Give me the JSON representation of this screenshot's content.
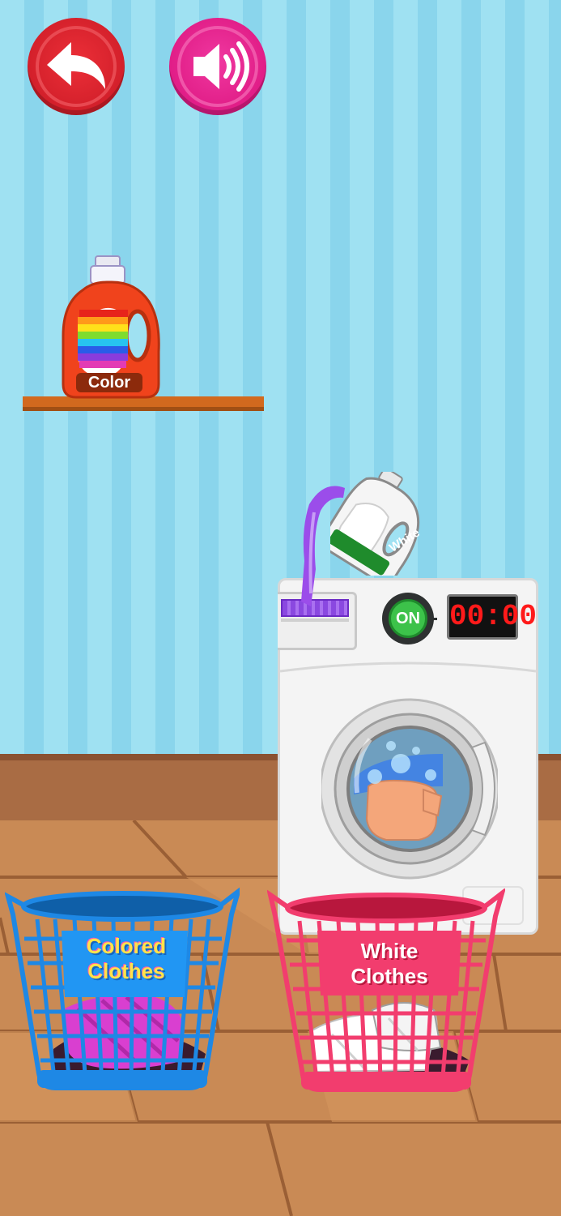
{
  "colors": {
    "wall_stripe_light": "#9fe1f2",
    "wall_stripe_dark": "#8ad5ec",
    "floor": "#c98a55",
    "back_button": "#e2242f",
    "sound_button": "#e81c8c",
    "colored_basket": "#2196f3",
    "white_basket": "#f23d6e",
    "timer_digits": "#ff1a1a",
    "on_button": "#3cc24a",
    "detergent_liquid": "#9b4dea"
  },
  "icons": {
    "back": "back-arrow-icon",
    "sound": "speaker-icon"
  },
  "detergents": {
    "color_bottle_label": "Color",
    "white_bottle_label": "White"
  },
  "washer": {
    "power_label": "ON",
    "timer": "00:00"
  },
  "baskets": {
    "colored": {
      "line1": "Colored",
      "line2": "Clothes"
    },
    "white": {
      "line1": "White",
      "line2": "Clothes"
    }
  }
}
